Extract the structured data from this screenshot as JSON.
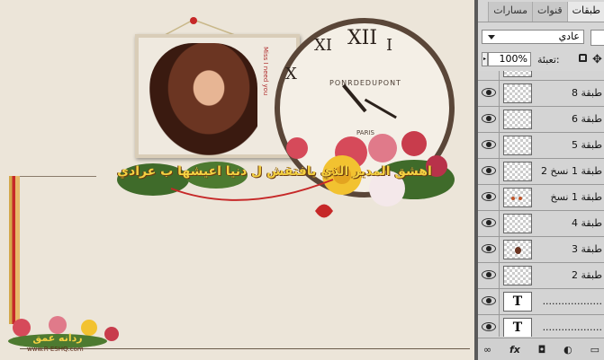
{
  "canvas": {
    "banner_text": "اهشق المدير الذي يافتقش ل دنيا اعيشها ب عرادي",
    "frame_text": "Miss I need you",
    "clock_brand": "PONRDEDUPONT",
    "clock_city": "PARIS",
    "clock_numerals": [
      "XII",
      "I",
      "XI",
      "X"
    ],
    "logo_text": "ردانه عمق",
    "logo_site": "www.R-ESHQ.com"
  },
  "panel": {
    "tabs": [
      {
        "label": "طبقات",
        "active": true
      },
      {
        "label": "قنوات",
        "active": false
      },
      {
        "label": "مسارات",
        "active": false
      }
    ],
    "blend_mode": "عادي",
    "opacity_label": "تعبئة:",
    "opacity_value": "100%",
    "layers": [
      {
        "name": "طبقة 8",
        "type": "raster"
      },
      {
        "name": "طبقة 6",
        "type": "raster"
      },
      {
        "name": "طبقة 5",
        "type": "raster"
      },
      {
        "name": "طبقة 1 نسخ 2",
        "type": "raster"
      },
      {
        "name": "طبقة 1 نسخ",
        "type": "raster"
      },
      {
        "name": "طبقة 4",
        "type": "raster"
      },
      {
        "name": "طبقة 3",
        "type": "raster"
      },
      {
        "name": "طبقة 2",
        "type": "raster"
      },
      {
        "name": "...................",
        "type": "text",
        "thumb": "T"
      },
      {
        "name": "...................",
        "type": "text",
        "thumb": "T"
      }
    ],
    "footer_icons": [
      "link-icon",
      "fx-icon",
      "mask-icon",
      "adjustment-icon",
      "folder-icon"
    ],
    "footer_glyphs": [
      "∞",
      "fx",
      "◘",
      "◐",
      "▭"
    ]
  },
  "colors": {
    "canvas_bg": "#ece5d9",
    "panel_bg": "#d6d6d6",
    "banner_text": "#f4d142"
  }
}
